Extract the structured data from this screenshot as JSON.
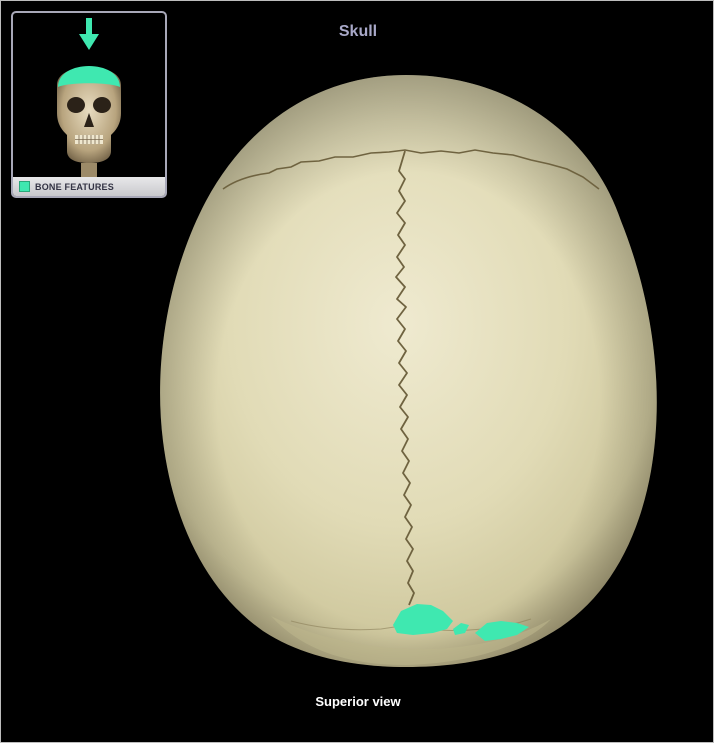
{
  "title": "Skull",
  "view_label": "Superior view",
  "thumbnail": {
    "legend_label": "BONE FEATURES",
    "arrow_icon": "down-arrow-icon",
    "skull_icon": "skull-front-icon"
  },
  "colors": {
    "highlight": "#3fe8b0",
    "bone": "#e2dcb8",
    "suture": "#6f6340",
    "title": "#a9a9c9",
    "background": "#000000"
  }
}
